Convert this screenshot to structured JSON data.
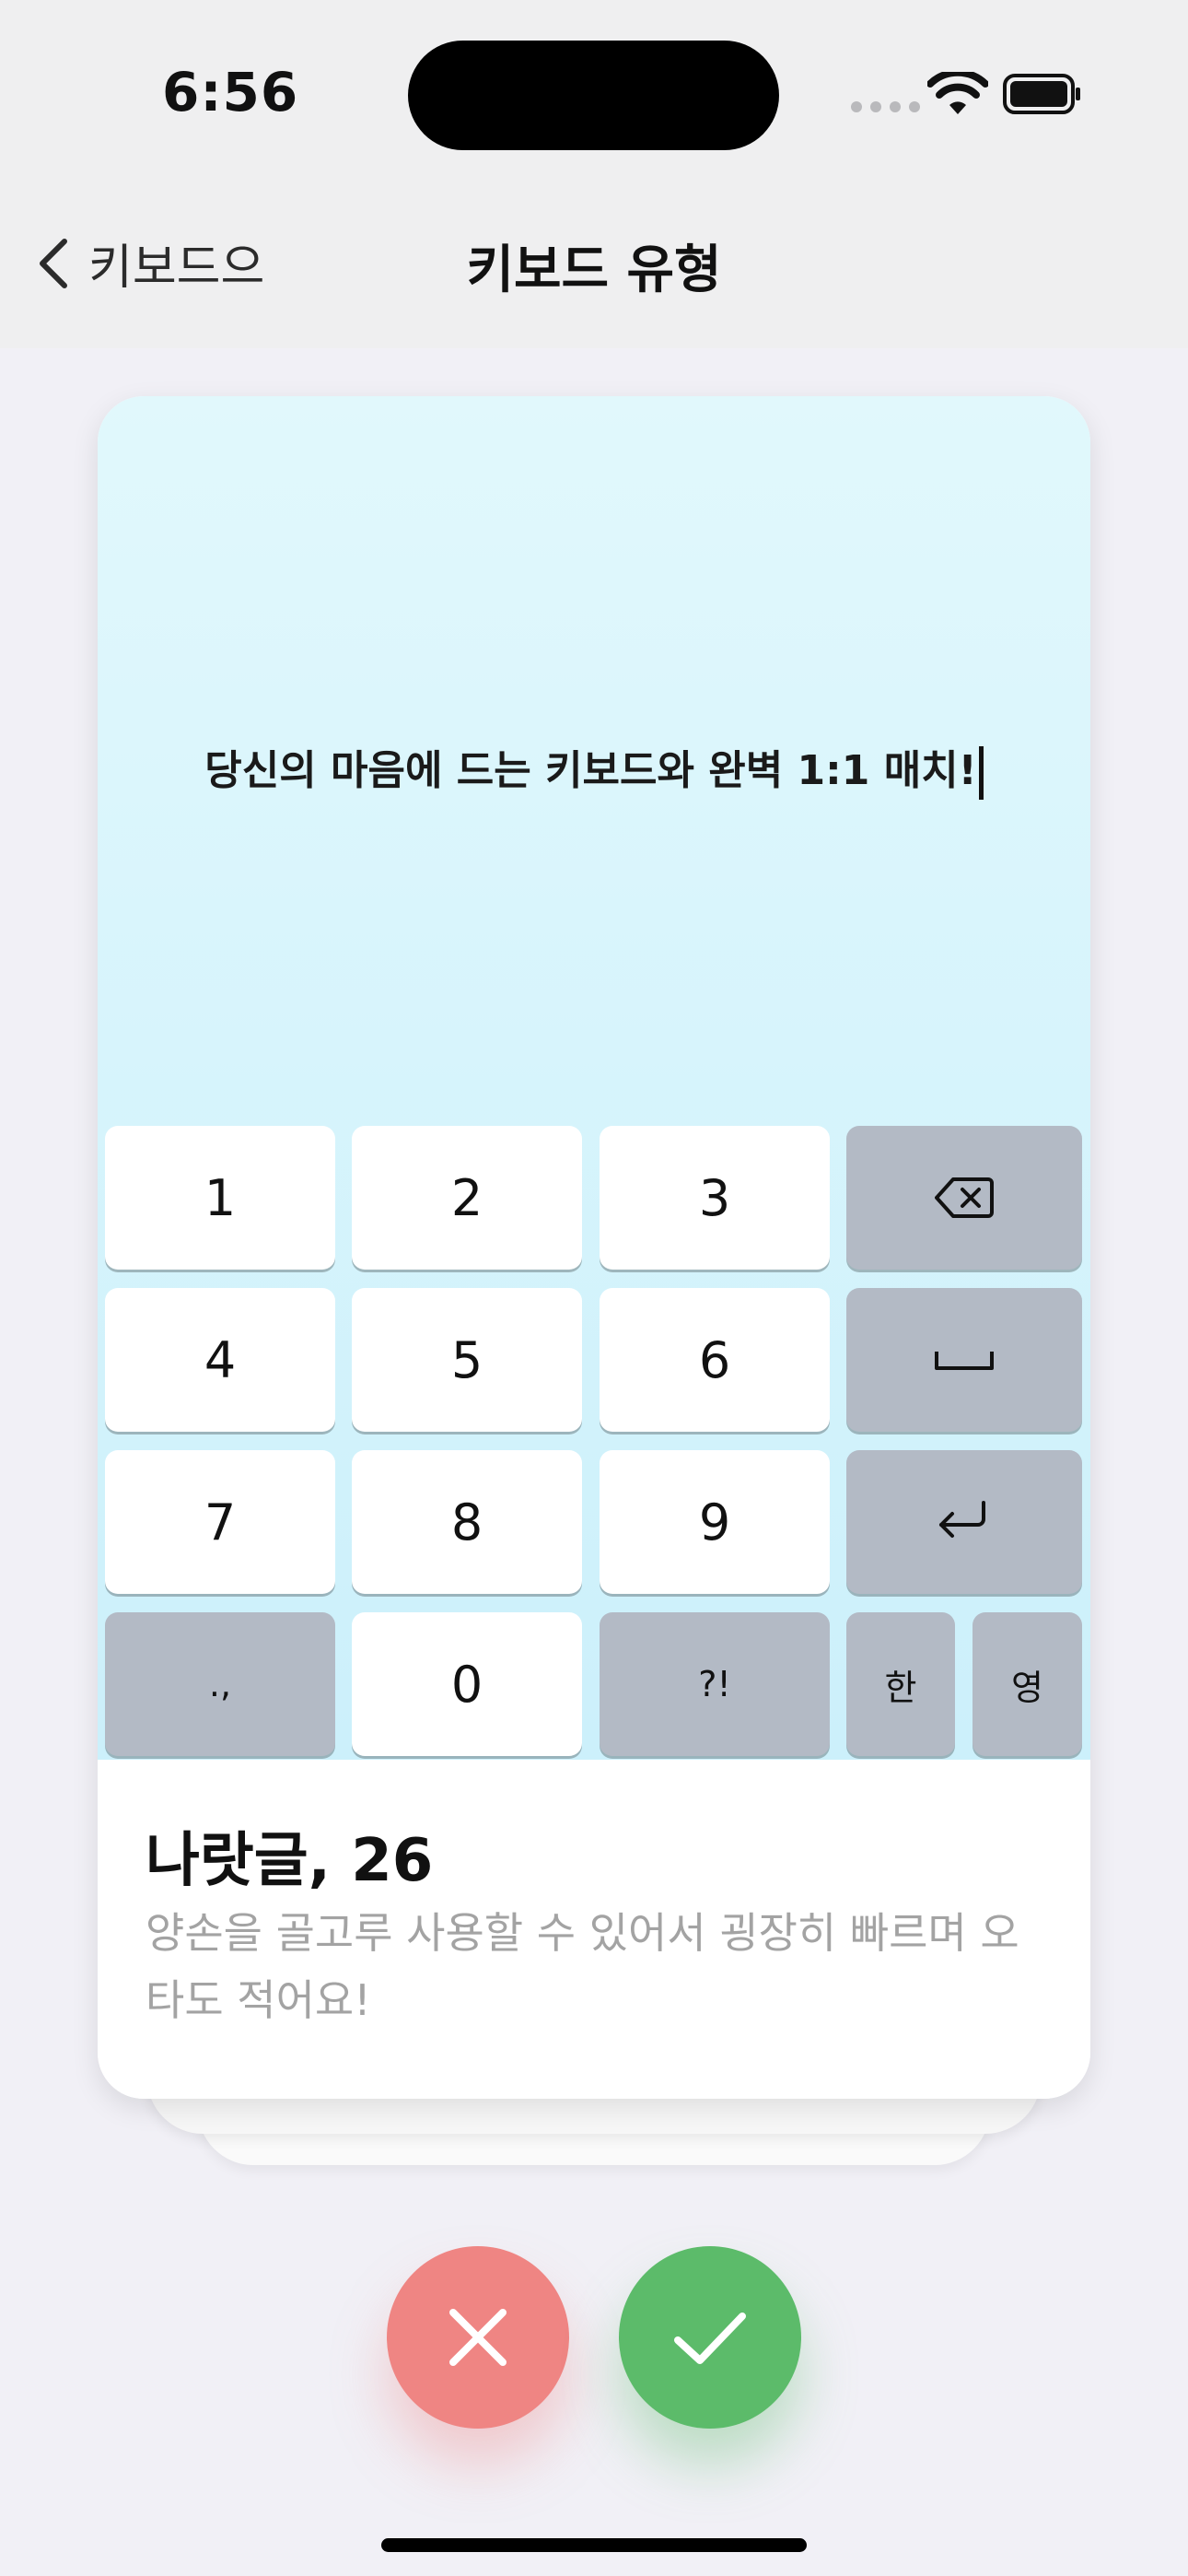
{
  "status_bar": {
    "time": "6:56"
  },
  "nav": {
    "back_label": "키보드으",
    "title": "키보드 유형"
  },
  "preview": {
    "sample_text": "당신의 마음에 드는 키보드와 완벽 1:1 매치!"
  },
  "keypad": {
    "rows": [
      [
        "1",
        "2",
        "3",
        "backspace"
      ],
      [
        "4",
        "5",
        "6",
        "space"
      ],
      [
        "7",
        "8",
        "9",
        "return"
      ],
      [
        ".,",
        "0",
        "?!",
        "한",
        "영"
      ]
    ]
  },
  "keyboard_info": {
    "name": "나랏글, 26",
    "description": "양손을 골고루 사용할 수 있어서 굉장히 빠르며 오타도 적어요!"
  },
  "actions": {
    "reject_icon": "close-icon",
    "accept_icon": "checkmark-icon"
  },
  "colors": {
    "reject": "#ef8583",
    "accept": "#5cbb6a",
    "preview_bg": "#d6f3fb",
    "gray_key": "#b3bac5"
  }
}
